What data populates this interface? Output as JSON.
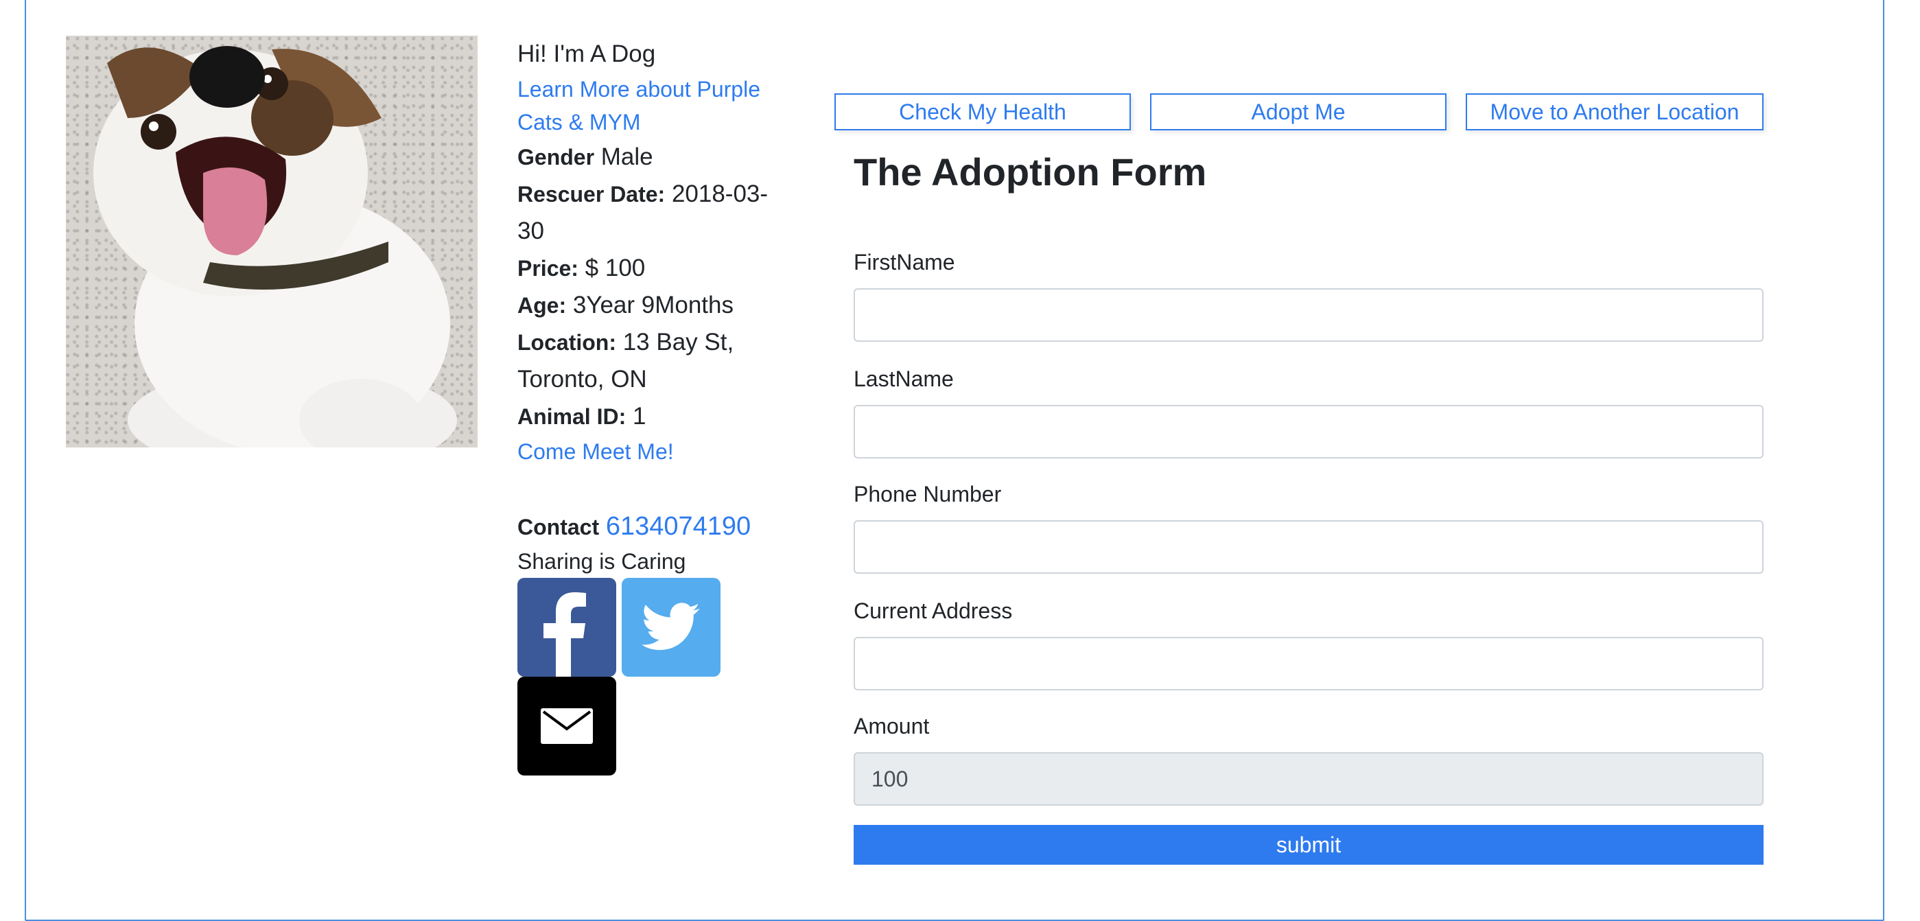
{
  "profile": {
    "greeting": "Hi! I'm A Dog",
    "learn_more": "Learn More about Purple Cats & MYM",
    "gender_label": "Gender",
    "gender": "Male",
    "rescuer_date_label": "Rescuer Date:",
    "rescuer_date": "2018-03-30",
    "price_label": "Price:",
    "price": "$ 100",
    "age_label": "Age:",
    "age": "3Year 9Months",
    "location_label": "Location:",
    "location": "13 Bay St, Toronto, ON",
    "animal_id_label": "Animal ID:",
    "animal_id": "1",
    "meet_link": "Come Meet Me!",
    "contact_label": "Contact",
    "contact_phone": "6134074190",
    "sharing_text": "Sharing is Caring",
    "icons": {
      "facebook": "facebook-icon",
      "twitter": "twitter-icon",
      "email": "email-icon"
    }
  },
  "tabs": [
    {
      "label": "Check My Health"
    },
    {
      "label": "Adopt Me"
    },
    {
      "label": "Move to Another Location"
    }
  ],
  "form": {
    "title": "The Adoption Form",
    "fields": [
      {
        "label": "FirstName",
        "value": ""
      },
      {
        "label": "LastName",
        "value": ""
      },
      {
        "label": "Phone Number",
        "value": ""
      },
      {
        "label": "Current Address",
        "value": ""
      },
      {
        "label": "Amount",
        "value": "100"
      }
    ],
    "submit_label": "submit"
  },
  "colors": {
    "accent": "#2e7bef",
    "facebook": "#3b5998",
    "twitter": "#55acee",
    "frame": "#4a8ee0"
  }
}
